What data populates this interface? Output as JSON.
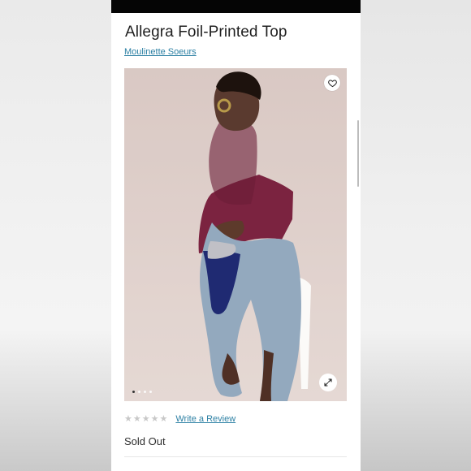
{
  "product": {
    "title": "Allegra Foil-Printed Top",
    "brand": "Moulinette Soeurs",
    "rating": {
      "stars": 0,
      "max": 5,
      "write_review_label": "Write a Review"
    },
    "availability": "Sold Out"
  },
  "gallery": {
    "current_slide": 1,
    "slide_count": 4,
    "icons": {
      "wishlist": "heart-icon",
      "zoom": "expand-icon"
    }
  },
  "colors": {
    "brand_link": "#2b7fa3",
    "title_text": "#1f1f1f",
    "star_empty": "#c8c8c8"
  }
}
